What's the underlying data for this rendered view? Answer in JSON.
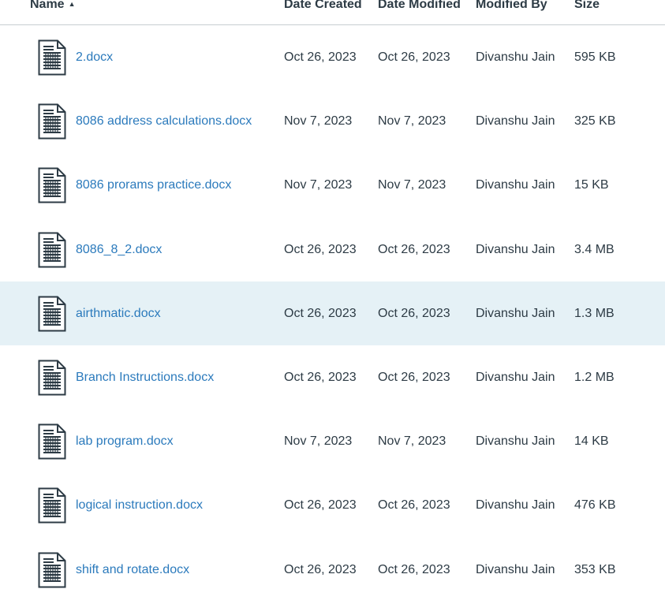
{
  "columns": {
    "name": "Name",
    "date_created": "Date Created",
    "date_modified": "Date Modified",
    "modified_by": "Modified By",
    "size": "Size",
    "sort_indicator": "▲"
  },
  "sort": {
    "column": "name",
    "direction": "ascending"
  },
  "selected_row": 4,
  "files": [
    {
      "name": "2.docx",
      "created": "Oct 26, 2023",
      "modified": "Oct 26, 2023",
      "modified_by": "Divanshu Jain",
      "size": "595 KB"
    },
    {
      "name": "8086 address calculations.docx",
      "created": "Nov 7, 2023",
      "modified": "Nov 7, 2023",
      "modified_by": "Divanshu Jain",
      "size": "325 KB"
    },
    {
      "name": "8086 prorams practice.docx",
      "created": "Nov 7, 2023",
      "modified": "Nov 7, 2023",
      "modified_by": "Divanshu Jain",
      "size": "15 KB"
    },
    {
      "name": "8086_8_2.docx",
      "created": "Oct 26, 2023",
      "modified": "Oct 26, 2023",
      "modified_by": "Divanshu Jain",
      "size": "3.4 MB"
    },
    {
      "name": "airthmatic.docx",
      "created": "Oct 26, 2023",
      "modified": "Oct 26, 2023",
      "modified_by": "Divanshu Jain",
      "size": "1.3 MB"
    },
    {
      "name": "Branch Instructions.docx",
      "created": "Oct 26, 2023",
      "modified": "Oct 26, 2023",
      "modified_by": "Divanshu Jain",
      "size": "1.2 MB"
    },
    {
      "name": "lab program.docx",
      "created": "Nov 7, 2023",
      "modified": "Nov 7, 2023",
      "modified_by": "Divanshu Jain",
      "size": "14 KB"
    },
    {
      "name": "logical instruction.docx",
      "created": "Oct 26, 2023",
      "modified": "Oct 26, 2023",
      "modified_by": "Divanshu Jain",
      "size": "476 KB"
    },
    {
      "name": "shift and rotate.docx",
      "created": "Oct 26, 2023",
      "modified": "Oct 26, 2023",
      "modified_by": "Divanshu Jain",
      "size": "353 KB"
    }
  ],
  "icons": {
    "file": "document-icon",
    "sort": "sort-ascending-icon"
  },
  "colors": {
    "link": "#2b7abc",
    "text": "#2d3b45",
    "selected_row": "#e5f1f6",
    "divider": "#c7cdd1"
  }
}
